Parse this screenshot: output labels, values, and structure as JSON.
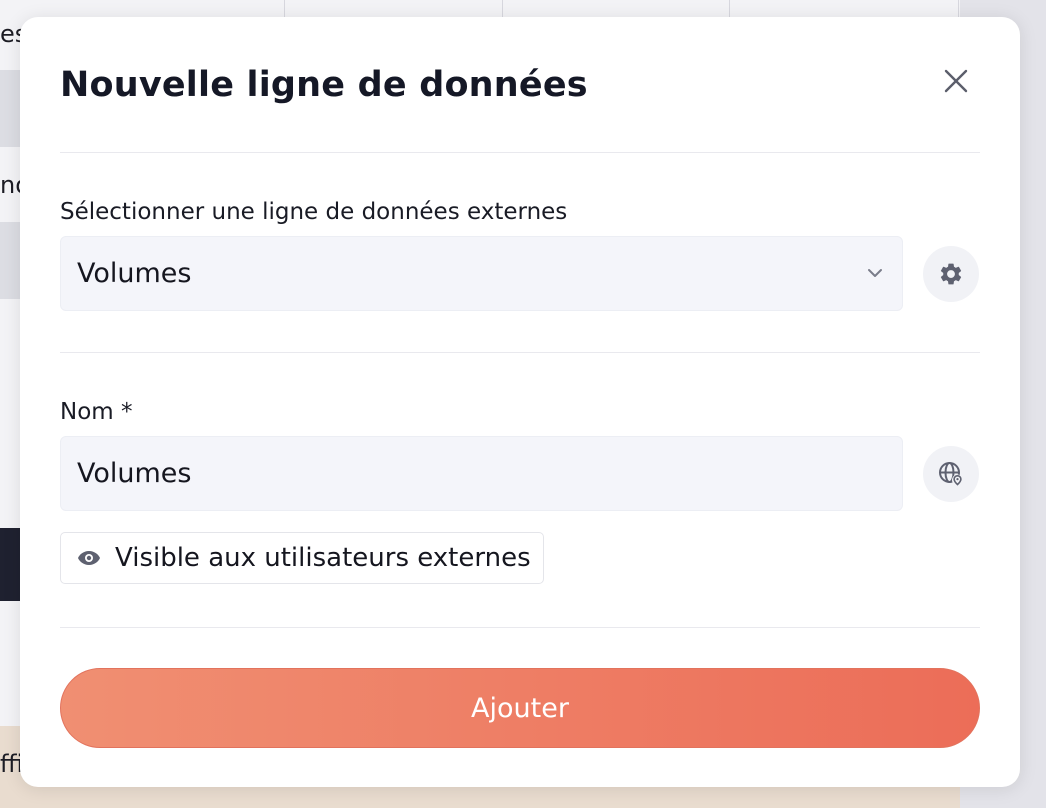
{
  "background": {
    "left_fragments": [
      "es",
      "no",
      "ffi"
    ]
  },
  "modal": {
    "title": "Nouvelle ligne de données",
    "close_icon": "close-icon",
    "external_row": {
      "label": "Sélectionner une ligne de données externes",
      "selected_value": "Volumes",
      "chevron_icon": "chevron-down-icon",
      "settings_icon": "gear-icon"
    },
    "name_field": {
      "label": "Nom *",
      "value": "Volumes",
      "translate_icon": "globe-icon"
    },
    "visibility": {
      "icon": "eye-icon",
      "label": "Visible aux utilisateurs externes"
    },
    "submit_label": "Ajouter",
    "colors": {
      "submit_gradient_start": "#f08f72",
      "submit_gradient_end": "#ec6d58",
      "input_background": "#f4f5fa",
      "title_text": "#151826"
    }
  }
}
